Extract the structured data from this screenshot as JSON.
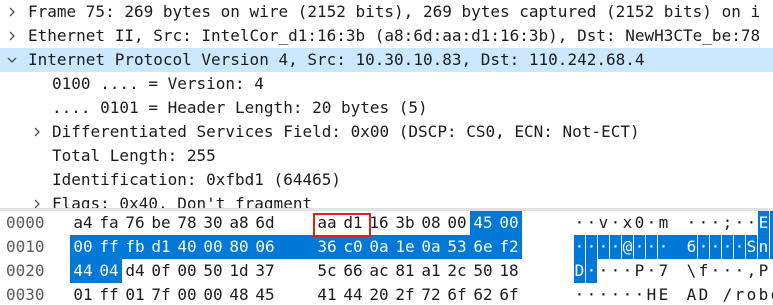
{
  "colors": {
    "selected_row_bg": "#cce8ff",
    "hex_highlight_bg": "#0078d7",
    "field_box": "#e0201b"
  },
  "tree": {
    "rows": [
      {
        "text": "Frame 75: 269 bytes on wire (2152 bits), 269 bytes captured (2152 bits) on i",
        "arrow": "collapsed"
      },
      {
        "text": "Ethernet II, Src: IntelCor_d1:16:3b (a8:6d:aa:d1:16:3b), Dst: NewH3CTe_be:78",
        "arrow": "collapsed"
      },
      {
        "text": "Internet Protocol Version 4, Src: 10.30.10.83, Dst: 110.242.68.4",
        "arrow": "expanded",
        "selected": true
      },
      {
        "text": "0100 .... = Version: 4",
        "arrow": "none"
      },
      {
        "text": ".... 0101 = Header Length: 20 bytes (5)",
        "arrow": "none"
      },
      {
        "text": "Differentiated Services Field: 0x00 (DSCP: CS0, ECN: Not-ECT)",
        "arrow": "collapsed"
      },
      {
        "text": "Total Length: 255",
        "arrow": "none"
      },
      {
        "text": "Identification: 0xfbd1 (64465)",
        "arrow": "none"
      },
      {
        "text": "Flags: 0x40, Don't fragment",
        "arrow": "collapsed"
      }
    ]
  },
  "hex": {
    "rows": [
      {
        "offset": "0000",
        "bytes": [
          "a4",
          "fa",
          "76",
          "be",
          "78",
          "30",
          "a8",
          "6d",
          "aa",
          "d1",
          "16",
          "3b",
          "08",
          "00",
          "45",
          "00"
        ],
        "ascii": [
          "·",
          "·",
          "v",
          "·",
          "x",
          "0",
          "·",
          "m",
          "·",
          "·",
          "·",
          ";",
          "·",
          "·",
          "E",
          "·"
        ]
      },
      {
        "offset": "0010",
        "bytes": [
          "00",
          "ff",
          "fb",
          "d1",
          "40",
          "00",
          "80",
          "06",
          "36",
          "c0",
          "0a",
          "1e",
          "0a",
          "53",
          "6e",
          "f2"
        ],
        "ascii": [
          "·",
          "·",
          "·",
          "·",
          "@",
          "·",
          "·",
          "·",
          "6",
          "·",
          "·",
          "·",
          "·",
          "S",
          "n",
          "·"
        ]
      },
      {
        "offset": "0020",
        "bytes": [
          "44",
          "04",
          "d4",
          "0f",
          "00",
          "50",
          "1d",
          "37",
          "5c",
          "66",
          "ac",
          "81",
          "a1",
          "2c",
          "50",
          "18"
        ],
        "ascii": [
          "D",
          "·",
          "·",
          "·",
          "·",
          "P",
          "·",
          "7",
          "\\",
          "f",
          "·",
          "·",
          "·",
          ",",
          "P",
          "·"
        ]
      },
      {
        "offset": "0030",
        "bytes": [
          "01",
          "ff",
          "01",
          "7f",
          "00",
          "00",
          "48",
          "45",
          "41",
          "44",
          "20",
          "2f",
          "72",
          "6f",
          "62",
          "6f"
        ],
        "ascii": [
          "·",
          "·",
          "·",
          "·",
          "·",
          "·",
          "H",
          "E",
          "A",
          "D",
          " ",
          "/",
          "r",
          "o",
          "b",
          "o"
        ]
      }
    ]
  }
}
